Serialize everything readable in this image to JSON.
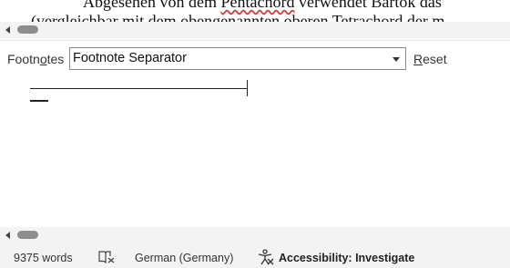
{
  "document": {
    "line1_a": "Abgesehen von dem ",
    "line1_b": "Pentachord",
    "line1_c": " verwendet Bartók das",
    "line2": "(vergleichbar mit dem obengenannten oberen Tetrachord der m"
  },
  "footnotes_pane": {
    "label_pre": "Footn",
    "label_key": "o",
    "label_post": "tes",
    "selected": "Footnote Separator",
    "reset_key": "R",
    "reset_rest": "eset"
  },
  "status_bar": {
    "word_count": "9375 words",
    "language": "German (Germany)",
    "accessibility": "Accessibility: Investigate",
    "icons": [
      "proofing-book-icon",
      "accessibility-icon"
    ]
  }
}
